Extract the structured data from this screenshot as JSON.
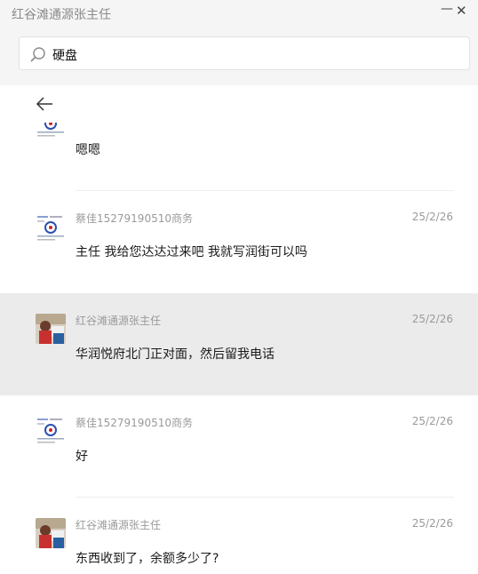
{
  "window": {
    "title": "红谷滩通源张主任",
    "minimize_glyph": "—",
    "close_glyph": "✕"
  },
  "search": {
    "value": "硬盘"
  },
  "icons": {
    "search": "search-icon",
    "back": "arrow-left-icon"
  },
  "messages": [
    {
      "name": "",
      "date": "",
      "text": "嗯嗯",
      "avatar": "qr-avatar"
    },
    {
      "name": "蔡佳15279190510商务",
      "date": "25/2/26",
      "text": "主任 我给您达达过来吧 我就写润街可以吗",
      "avatar": "qr-avatar"
    },
    {
      "name": "红谷滩通源张主任",
      "date": "25/2/26",
      "text": "华润悦府北门正对面，然后留我电话",
      "avatar": "photo-avatar"
    },
    {
      "name": "蔡佳15279190510商务",
      "date": "25/2/26",
      "text": "好",
      "avatar": "qr-avatar"
    },
    {
      "name": "红谷滩通源张主任",
      "date": "25/2/26",
      "text": "东西收到了，余额多少了?",
      "avatar": "photo-avatar"
    }
  ]
}
